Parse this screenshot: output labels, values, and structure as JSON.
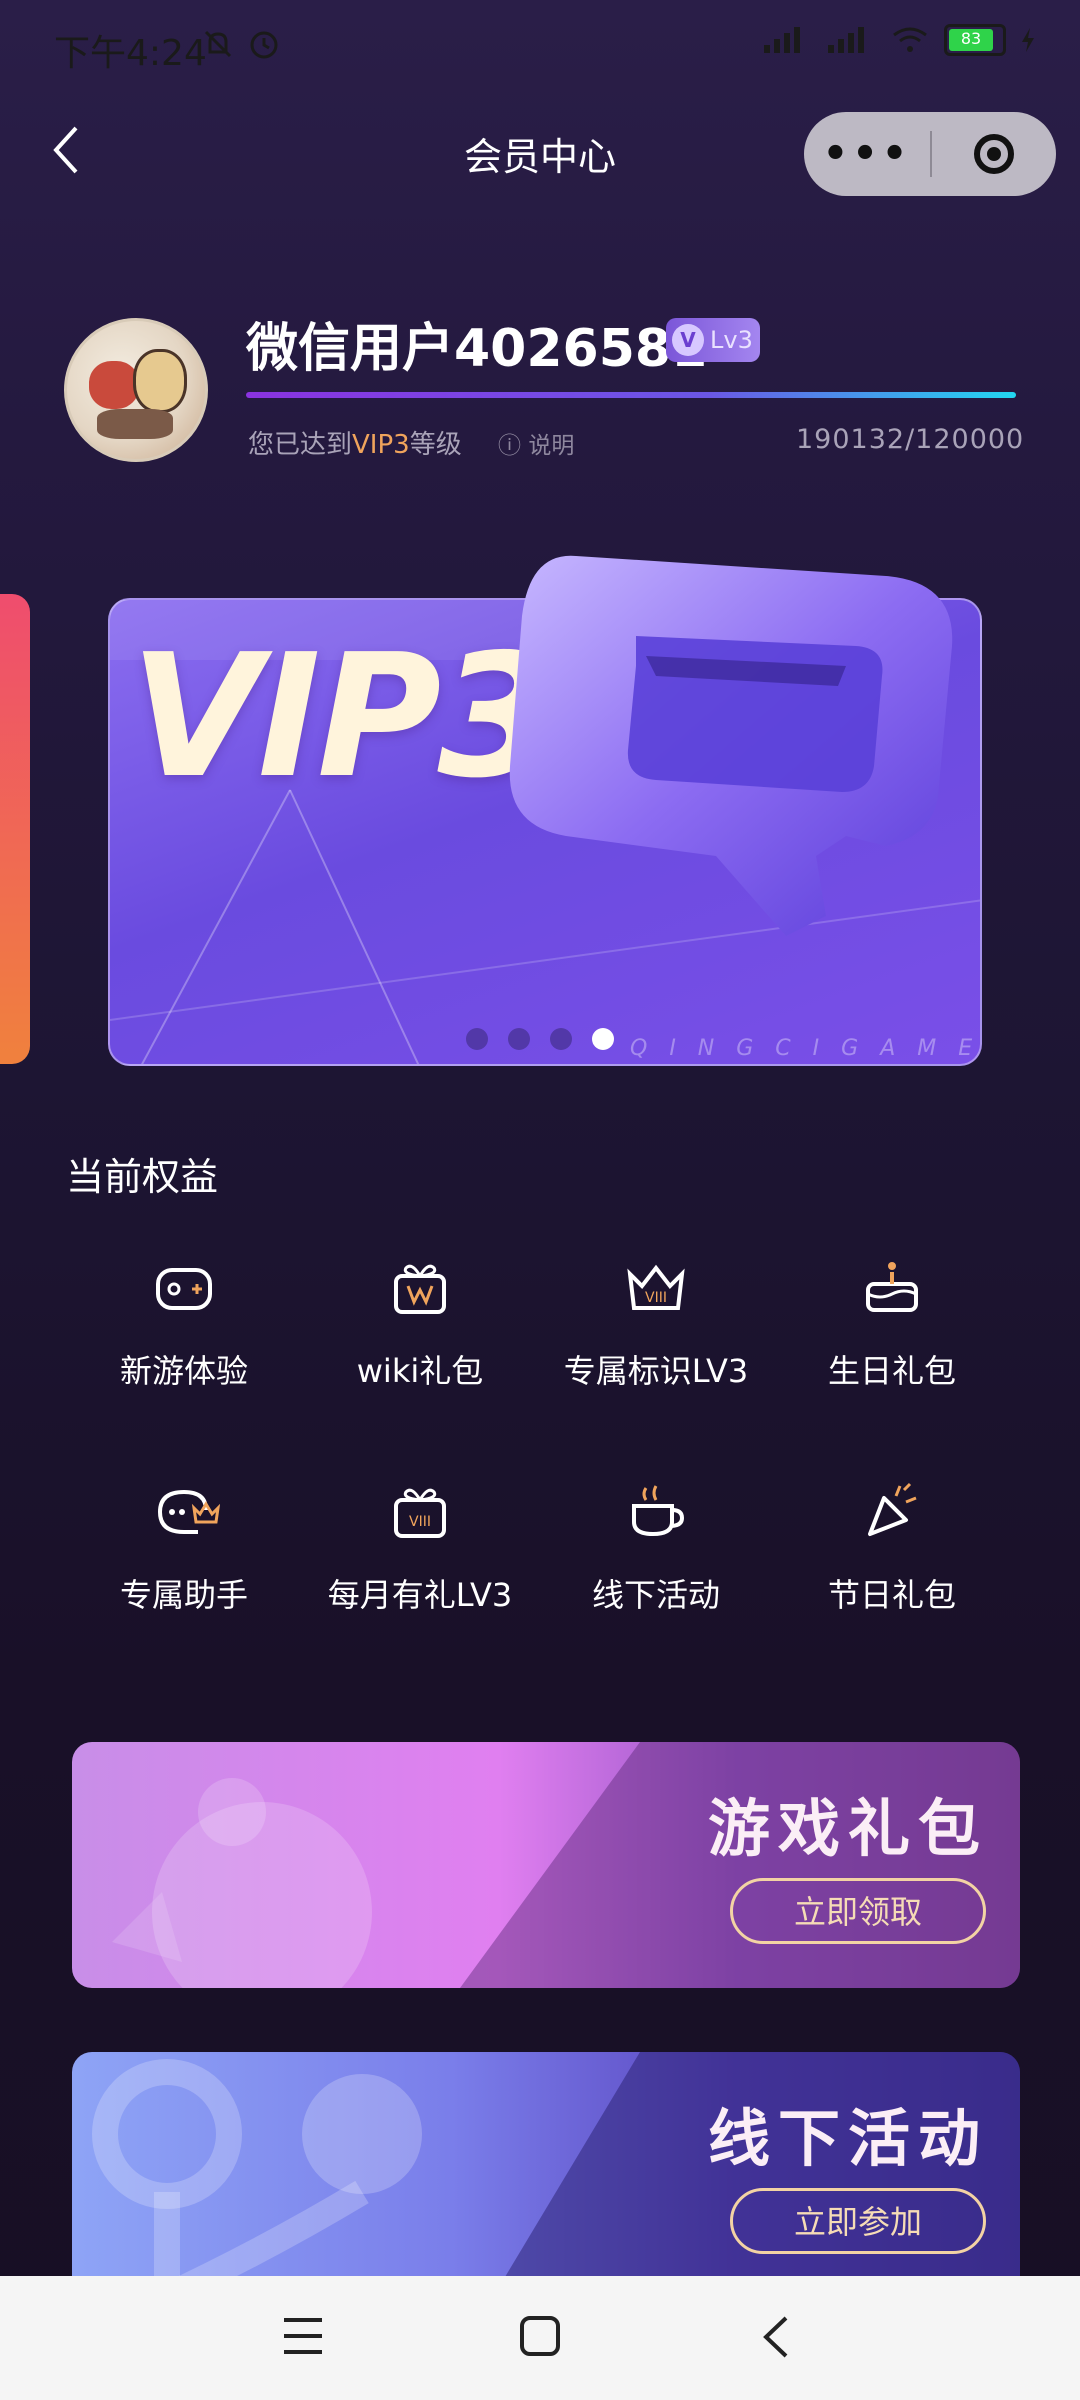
{
  "status_bar": {
    "time": "下午4:24",
    "battery": "83"
  },
  "header": {
    "title": "会员中心"
  },
  "profile": {
    "username": "微信用户4026581",
    "level_badge": "Lv3",
    "status_prefix": "您已达到",
    "status_level": "VIP3",
    "status_suffix": "等级",
    "help_label": "说明",
    "experience": "190132/120000"
  },
  "banner": {
    "card_title": "VIP3",
    "brand": "QINGCIGAME",
    "page_count": 4,
    "active_page": 4
  },
  "benefits": {
    "title": "当前权益",
    "items": [
      {
        "label": "新游体验",
        "icon": "gamepad-icon"
      },
      {
        "label": "wiki礼包",
        "icon": "gift-w-icon"
      },
      {
        "label": "专属标识LV3",
        "icon": "crown-icon"
      },
      {
        "label": "生日礼包",
        "icon": "cake-icon"
      },
      {
        "label": "专属助手",
        "icon": "assistant-chat-icon"
      },
      {
        "label": "每月有礼LV3",
        "icon": "gift-monthly-icon"
      },
      {
        "label": "线下活动",
        "icon": "coffee-cup-icon"
      },
      {
        "label": "节日礼包",
        "icon": "party-popper-icon"
      }
    ]
  },
  "promos": {
    "games": {
      "title": "游戏礼包",
      "button": "立即领取"
    },
    "events": {
      "title": "线下活动",
      "button": "立即参加"
    }
  },
  "colors": {
    "accent": "#f0a45c",
    "progress_start": "#8a33e0",
    "progress_end": "#22d7f0"
  }
}
